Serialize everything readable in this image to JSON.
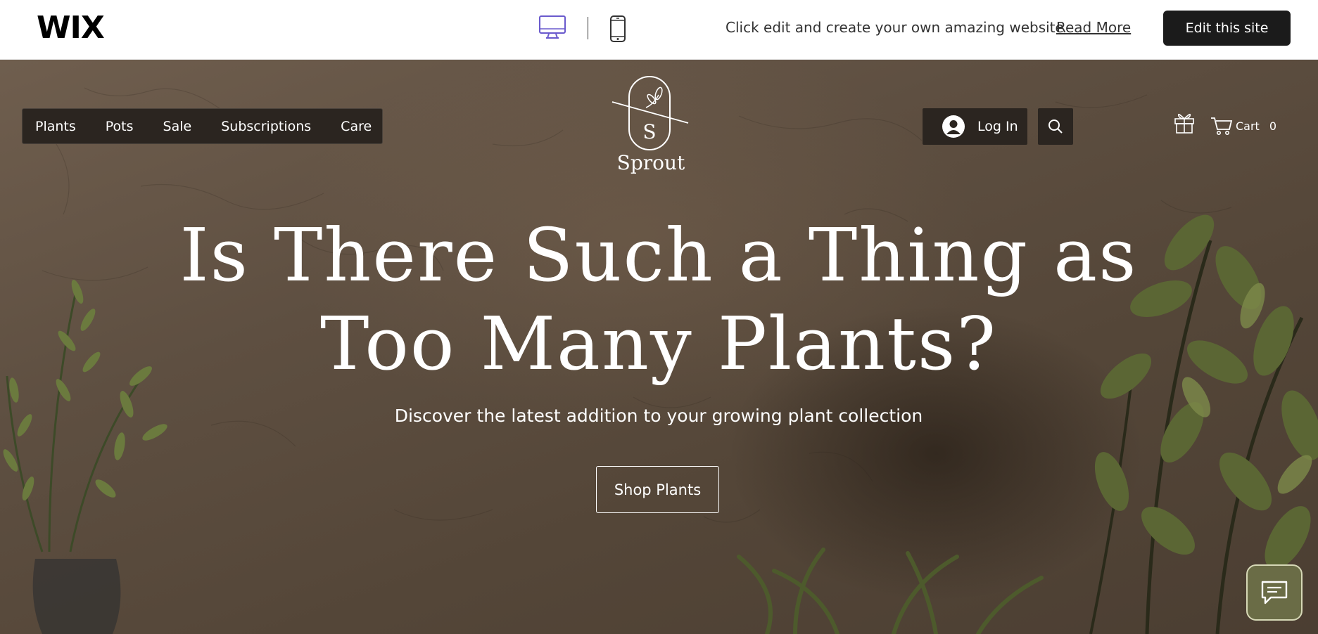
{
  "wix_bar": {
    "logo": "WIX",
    "promo_text": "Click edit and create your own amazing website",
    "read_more_label": "Read More",
    "edit_button_label": "Edit this site",
    "desktop_icon": "desktop-icon",
    "mobile_icon": "mobile-icon",
    "active_device_color": "#6a5acd"
  },
  "site": {
    "nav": {
      "items": [
        {
          "label": "Plants"
        },
        {
          "label": "Pots"
        },
        {
          "label": "Sale"
        },
        {
          "label": "Subscriptions"
        },
        {
          "label": "Care"
        }
      ]
    },
    "brand": {
      "monogram": "S",
      "name": "Sprout"
    },
    "login_label": "Log In",
    "cart": {
      "label": "Cart",
      "count": "0"
    },
    "hero": {
      "headline_line1": "Is There Such a Thing as",
      "headline_line2": "Too Many Plants?",
      "subline": "Discover the latest addition to your growing plant collection",
      "cta_label": "Shop Plants"
    }
  },
  "colors": {
    "nav_bg": "#2b2520",
    "chat_bg": "#6a6c46",
    "edit_button_bg": "#1b1b1b"
  }
}
